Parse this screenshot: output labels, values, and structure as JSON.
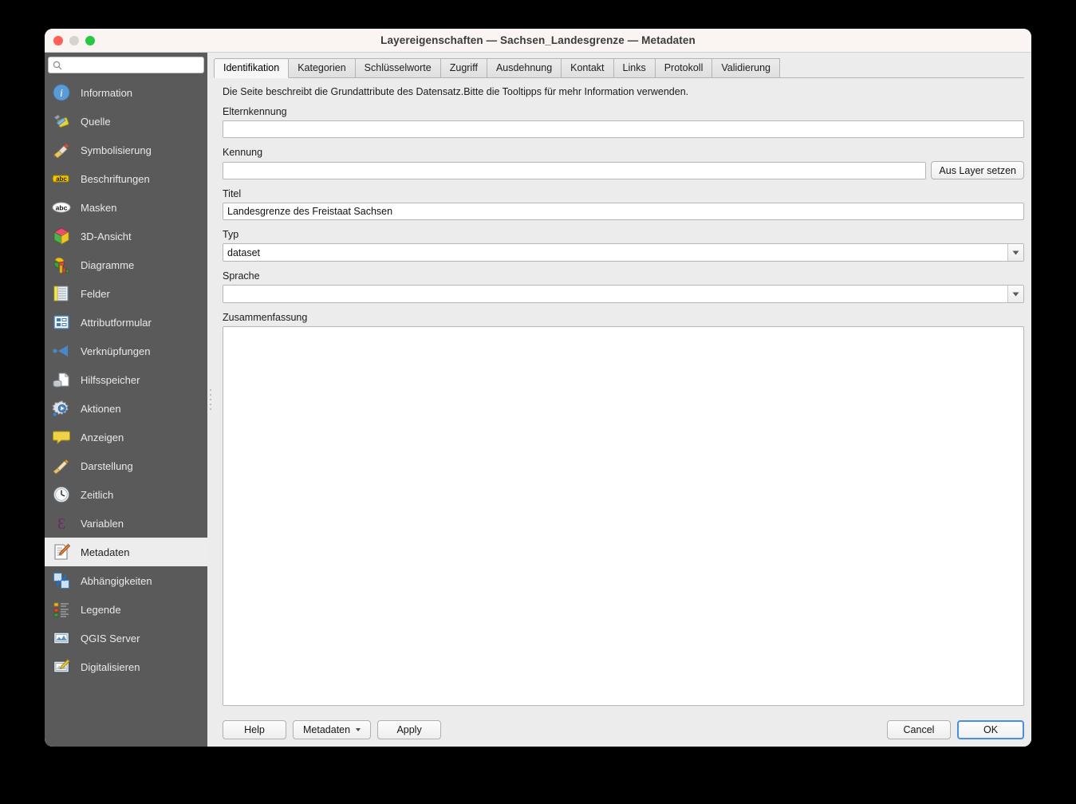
{
  "window": {
    "title": "Layereigenschaften — Sachsen_Landesgrenze — Metadaten",
    "controls": {
      "close": "close",
      "minimize": "minimize",
      "zoom": "zoom"
    }
  },
  "sidebar": {
    "search": {
      "value": "",
      "placeholder": ""
    },
    "items": [
      {
        "label": "Information",
        "icon": "information-icon",
        "selected": false
      },
      {
        "label": "Quelle",
        "icon": "source-icon",
        "selected": false
      },
      {
        "label": "Symbolisierung",
        "icon": "symbology-icon",
        "selected": false
      },
      {
        "label": "Beschriftungen",
        "icon": "labels-abc-icon",
        "selected": false
      },
      {
        "label": "Masken",
        "icon": "masks-abc-icon",
        "selected": false
      },
      {
        "label": "3D-Ansicht",
        "icon": "3d-view-cube-icon",
        "selected": false
      },
      {
        "label": "Diagramme",
        "icon": "diagrams-chart-icon",
        "selected": false
      },
      {
        "label": "Felder",
        "icon": "fields-table-icon",
        "selected": false
      },
      {
        "label": "Attributformular",
        "icon": "attribute-form-icon",
        "selected": false
      },
      {
        "label": "Verknüpfungen",
        "icon": "joins-icon",
        "selected": false
      },
      {
        "label": "Hilfsspeicher",
        "icon": "auxiliary-storage-icon",
        "selected": false
      },
      {
        "label": "Aktionen",
        "icon": "actions-gear-icon",
        "selected": false
      },
      {
        "label": "Anzeigen",
        "icon": "display-balloon-icon",
        "selected": false
      },
      {
        "label": "Darstellung",
        "icon": "rendering-brush-icon",
        "selected": false
      },
      {
        "label": "Zeitlich",
        "icon": "temporal-clock-icon",
        "selected": false
      },
      {
        "label": "Variablen",
        "icon": "variables-epsilon-icon",
        "selected": false
      },
      {
        "label": "Metadaten",
        "icon": "metadata-pencil-icon",
        "selected": true
      },
      {
        "label": "Abhängigkeiten",
        "icon": "dependencies-icon",
        "selected": false
      },
      {
        "label": "Legende",
        "icon": "legend-icon",
        "selected": false
      },
      {
        "label": "QGIS Server",
        "icon": "qgis-server-icon",
        "selected": false
      },
      {
        "label": "Digitalisieren",
        "icon": "digitizing-icon",
        "selected": false
      }
    ]
  },
  "tabs": [
    {
      "label": "Identifikation",
      "active": true
    },
    {
      "label": "Kategorien",
      "active": false
    },
    {
      "label": "Schlüsselworte",
      "active": false
    },
    {
      "label": "Zugriff",
      "active": false
    },
    {
      "label": "Ausdehnung",
      "active": false
    },
    {
      "label": "Kontakt",
      "active": false
    },
    {
      "label": "Links",
      "active": false
    },
    {
      "label": "Protokoll",
      "active": false
    },
    {
      "label": "Validierung",
      "active": false
    }
  ],
  "form": {
    "intro": "Die Seite beschreibt die Grundattribute des Datensatz.Bitte die Tooltipps für mehr Information verwenden.",
    "parent_id": {
      "label": "Elternkennung",
      "value": "",
      "placeholder": ""
    },
    "identifier": {
      "label": "Kennung",
      "value": "",
      "placeholder": "",
      "set_from_layer_label": "Aus Layer setzen"
    },
    "title": {
      "label": "Titel",
      "value": "Landesgrenze des Freistaat Sachsen",
      "placeholder": ""
    },
    "type": {
      "label": "Typ",
      "value": "dataset",
      "arrow_icon": "chevron-down-icon"
    },
    "language": {
      "label": "Sprache",
      "value": "",
      "arrow_icon": "chevron-down-icon"
    },
    "abstract": {
      "label": "Zusammenfassung",
      "value": "",
      "placeholder": ""
    }
  },
  "footer": {
    "help": "Help",
    "metadata_menu": "Metadaten",
    "metadata_menu_icon": "caret-down-icon",
    "apply": "Apply",
    "cancel": "Cancel",
    "ok": "OK"
  },
  "colors": {
    "sidebar_bg": "#5a5a5a",
    "panel_bg": "#ececec",
    "titlebar_bg": "#faf4f2",
    "selected_item_bg": "#ededed",
    "default_button_border": "#4a90e2",
    "close_light": "#ff5f57",
    "min_light": "#d6d2d0",
    "zoom_light": "#28c840"
  }
}
